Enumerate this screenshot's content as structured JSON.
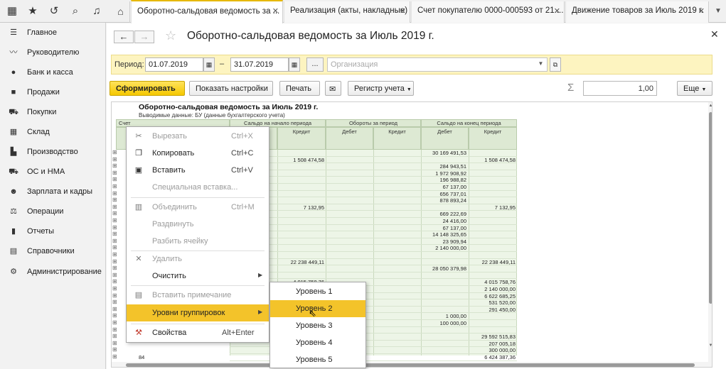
{
  "tabs": [
    {
      "label": "Оборотно-сальдовая ведомость за ..."
    },
    {
      "label": "Реализация (акты, накладные)"
    },
    {
      "label": "Счет покупателю 0000-000593 от 21...."
    },
    {
      "label": "Движение товаров  за Июль 2019 г."
    }
  ],
  "sidebar": {
    "items": [
      {
        "label": "Главное",
        "icon": "menu-icon"
      },
      {
        "label": "Руководителю",
        "icon": "chart-line-icon"
      },
      {
        "label": "Банк и касса",
        "icon": "coin-icon"
      },
      {
        "label": "Продажи",
        "icon": "briefcase-icon"
      },
      {
        "label": "Покупки",
        "icon": "cart-icon"
      },
      {
        "label": "Склад",
        "icon": "warehouse-icon"
      },
      {
        "label": "Производство",
        "icon": "factory-icon"
      },
      {
        "label": "ОС и НМА",
        "icon": "truck-icon"
      },
      {
        "label": "Зарплата и кадры",
        "icon": "person-icon"
      },
      {
        "label": "Операции",
        "icon": "operations-icon"
      },
      {
        "label": "Отчеты",
        "icon": "bar-chart-icon"
      },
      {
        "label": "Справочники",
        "icon": "book-icon"
      },
      {
        "label": "Администрирование",
        "icon": "gear-icon"
      }
    ]
  },
  "header": {
    "title": "Оборотно-сальдовая ведомость за Июль 2019 г."
  },
  "period": {
    "label": "Период:",
    "from": "01.07.2019",
    "dash": "–",
    "to": "31.07.2019",
    "dots": "...",
    "org_placeholder": "Организация"
  },
  "toolbar": {
    "generate": "Сформировать",
    "show_settings": "Показать настройки",
    "print": "Печать",
    "register": "Регистр учета",
    "sum": "1,00",
    "more": "Еще"
  },
  "report": {
    "title": "Оборотно-сальдовая ведомость за Июль 2019 г.",
    "subtitle": "Выводимые данные:  БУ (данные бухгалтерского учета)",
    "col_account": "Счет",
    "col_start": "Сальдо на начало периода",
    "col_turnover": "Обороты за период",
    "col_end": "Сальдо на конец периода",
    "debit": "Дебет",
    "credit": "Кредит",
    "rows": [
      {
        "acct": "",
        "sc": "",
        "ed": "30 169 491,53",
        "ec": ""
      },
      {
        "acct": "",
        "sc": "1 508 474,58",
        "ed": "",
        "ec": "1 508 474,58"
      },
      {
        "acct": "",
        "sc": "",
        "ed": "284 943,51",
        "ec": ""
      },
      {
        "acct": "",
        "sc": "",
        "ed": "1 972 908,92",
        "ec": ""
      },
      {
        "acct": "",
        "sc": "",
        "ed": "196 988,82",
        "ec": ""
      },
      {
        "acct": "",
        "sc": "",
        "ed": "67 137,00",
        "ec": ""
      },
      {
        "acct": "",
        "sc": "",
        "ed": "656 737,01",
        "ec": ""
      },
      {
        "acct": "",
        "sc": "",
        "ed": "878 893,24",
        "ec": ""
      },
      {
        "acct": "",
        "sc": "7 132,95",
        "ed": "",
        "ec": "7 132,95"
      },
      {
        "acct": "",
        "sc": "",
        "ed": "669 222,69",
        "ec": ""
      },
      {
        "acct": "",
        "sc": "",
        "ed": "24 416,00",
        "ec": ""
      },
      {
        "acct": "",
        "sc": "",
        "ed": "67 137,00",
        "ec": ""
      },
      {
        "acct": "",
        "sc": "",
        "ed": "14 148 325,65",
        "ec": ""
      },
      {
        "acct": "",
        "sc": "",
        "ed": "23 909,94",
        "ec": ""
      },
      {
        "acct": "",
        "sc": "",
        "ed": "2 140 000,00",
        "ec": ""
      },
      {
        "acct": "",
        "sc": "",
        "ed": "",
        "ec": ""
      },
      {
        "acct": "",
        "sc": "22 238 449,11",
        "ed": "",
        "ec": "22 238 449,11"
      },
      {
        "acct": "",
        "sc": "",
        "ed": "28 050 379,98",
        "ec": ""
      },
      {
        "acct": "",
        "sc": "",
        "ed": "",
        "ec": ""
      },
      {
        "acct": "",
        "sc": "4 015 758,76",
        "ed": "",
        "ec": "4 015 758,76"
      },
      {
        "acct": "",
        "sc": "2 140 000,00",
        "ed": "",
        "ec": "2 140 000,00"
      },
      {
        "acct": "",
        "sc": "",
        "ed": "",
        "ec": "6 622 685,25"
      },
      {
        "acct": "",
        "sc": "",
        "ed": "",
        "ec": "531 520,00"
      },
      {
        "acct": "",
        "sc": "",
        "ed": "",
        "ec": "291 450,00"
      },
      {
        "acct": "",
        "sc": "",
        "ed": "1 000,00",
        "ec": ""
      },
      {
        "acct": "",
        "sc": "",
        "ed": "100 000,00",
        "ec": ""
      },
      {
        "acct": "",
        "sc": "",
        "ed": "",
        "ec": ""
      },
      {
        "acct": "",
        "sc": "",
        "ed": "",
        "ec": "29 592 515,83"
      },
      {
        "acct": "",
        "sc": "",
        "ed": "",
        "ec": "207 005,18"
      },
      {
        "acct": "",
        "sc": "",
        "ed": "",
        "ec": "300 000,00"
      },
      {
        "acct": "84",
        "sc": "",
        "ed": "",
        "ec": "6 424 387,36"
      }
    ]
  },
  "context_menu": {
    "items": [
      {
        "label": "Вырезать",
        "key": "Ctrl+X",
        "icon": "scissors-icon",
        "disabled": true
      },
      {
        "label": "Копировать",
        "key": "Ctrl+C",
        "icon": "copy-icon",
        "disabled": false
      },
      {
        "label": "Вставить",
        "key": "Ctrl+V",
        "icon": "paste-icon",
        "disabled": false
      },
      {
        "label": "Специальная вставка...",
        "key": "",
        "icon": "",
        "disabled": true
      },
      {
        "label": "Объединить",
        "key": "Ctrl+M",
        "icon": "merge-icon",
        "disabled": true
      },
      {
        "label": "Раздвинуть",
        "key": "",
        "icon": "",
        "disabled": true
      },
      {
        "label": "Разбить ячейку",
        "key": "",
        "icon": "",
        "disabled": true
      },
      {
        "label": "Удалить",
        "key": "",
        "icon": "delete-icon",
        "disabled": true
      },
      {
        "label": "Очистить",
        "key": "",
        "icon": "",
        "disabled": false
      },
      {
        "label": "Вставить примечание",
        "key": "",
        "icon": "note-icon",
        "disabled": true
      },
      {
        "label": "Уровни группировок",
        "key": "",
        "icon": "",
        "disabled": false
      },
      {
        "label": "Свойства",
        "key": "Alt+Enter",
        "icon": "properties-icon",
        "disabled": false
      }
    ]
  },
  "submenu": {
    "items": [
      "Уровень 1",
      "Уровень 2",
      "Уровень 3",
      "Уровень 4",
      "Уровень 5"
    ]
  }
}
